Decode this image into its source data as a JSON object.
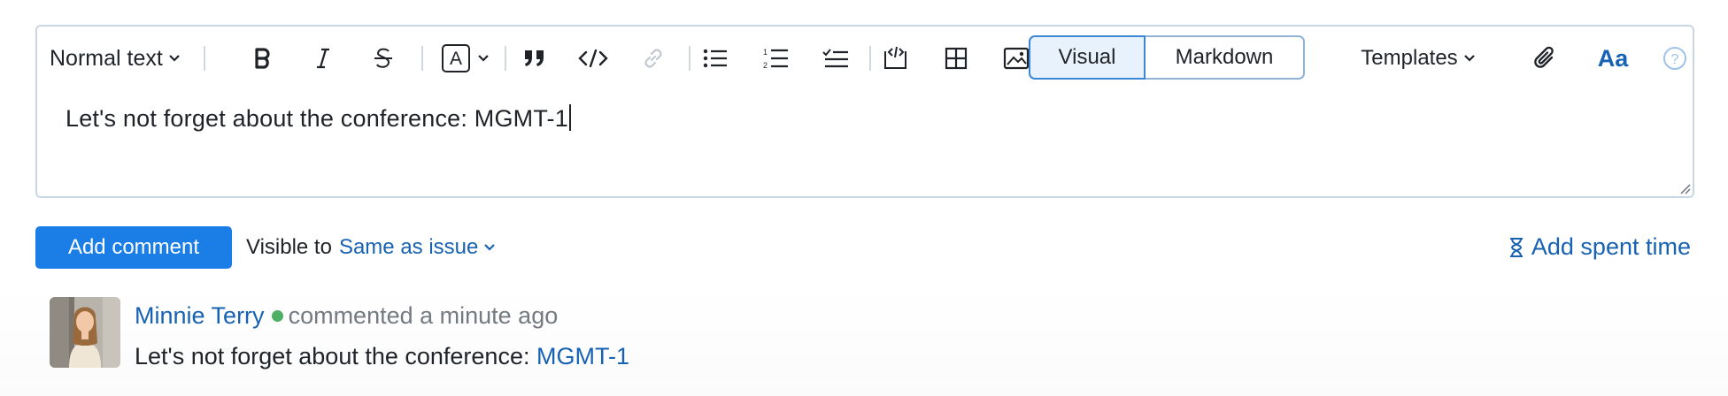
{
  "editor": {
    "toolbar": {
      "format_label": "Normal text",
      "color_letter": "A",
      "mode_visual": "Visual",
      "mode_markdown": "Markdown",
      "templates_label": "Templates",
      "aa_label": "Aa"
    },
    "content": "Let's not forget about the conference: MGMT-1"
  },
  "actions": {
    "add_comment_label": "Add comment",
    "visible_prefix": "Visible to",
    "visible_value": "Same as issue",
    "spent_time_label": "Add spent time"
  },
  "comment": {
    "author": "Minnie Terry",
    "meta": "commented a minute ago",
    "text_prefix": "Let's not forget about the conference: ",
    "issue_link": "MGMT-1"
  },
  "colors": {
    "accent": "#1a7ee6",
    "link": "#1762b3",
    "online": "#4caf64",
    "border": "#c9d6e3"
  },
  "icons": [
    "chevron-down-icon",
    "bold-icon",
    "italic-icon",
    "strikethrough-icon",
    "text-color-icon",
    "quote-icon",
    "code-icon",
    "link-icon",
    "bulleted-list-icon",
    "numbered-list-icon",
    "checklist-icon",
    "code-block-icon",
    "table-icon",
    "image-icon",
    "paperclip-icon",
    "help-icon",
    "hourglass-icon",
    "resize-handle-icon"
  ]
}
